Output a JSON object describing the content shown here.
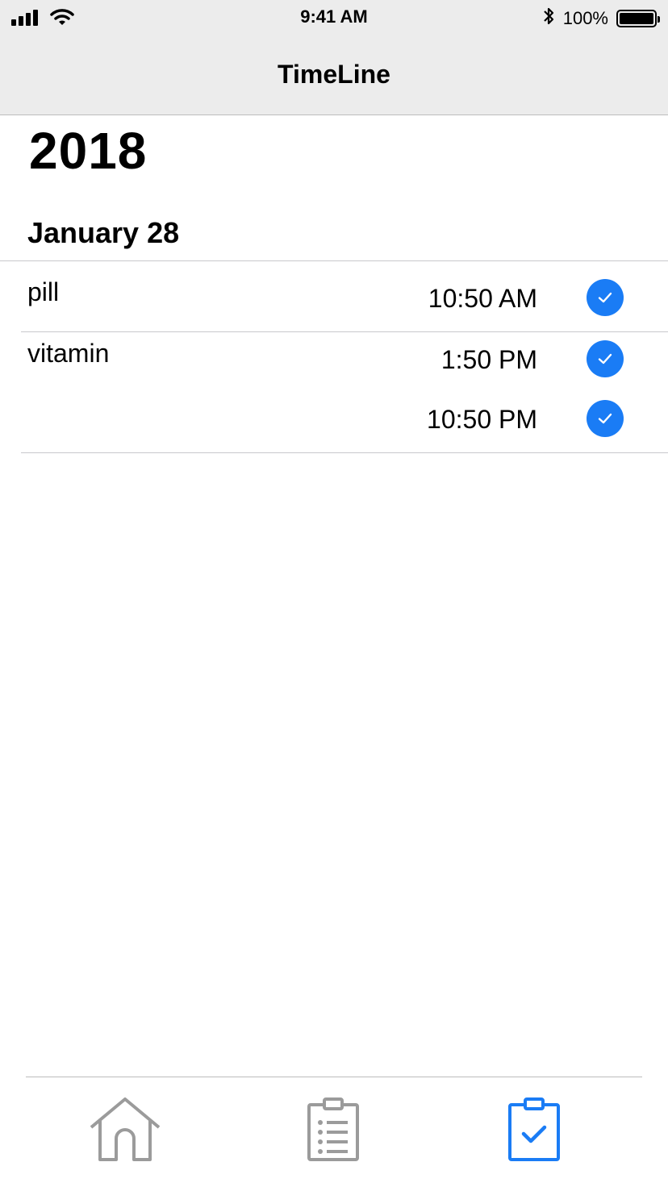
{
  "status_bar": {
    "time": "9:41 AM",
    "battery_percent": "100%",
    "battery_level": 1.0
  },
  "nav": {
    "title": "TimeLine"
  },
  "timeline": {
    "year": "2018",
    "date": "January 28",
    "entries": [
      {
        "name": "pill",
        "doses": [
          {
            "time": "10:50 AM",
            "taken": true
          }
        ]
      },
      {
        "name": "vitamin",
        "doses": [
          {
            "time": "1:50 PM",
            "taken": true
          },
          {
            "time": "10:50 PM",
            "taken": true
          }
        ]
      }
    ]
  },
  "tab_bar": {
    "tabs": [
      {
        "icon": "home-icon",
        "active": false
      },
      {
        "icon": "list-clipboard-icon",
        "active": false
      },
      {
        "icon": "check-clipboard-icon",
        "active": true
      }
    ],
    "active_color": "#1a7cf5",
    "inactive_color": "#9b9b9b"
  },
  "colors": {
    "accent": "#1a7cf5",
    "nav_background": "#ececec"
  }
}
